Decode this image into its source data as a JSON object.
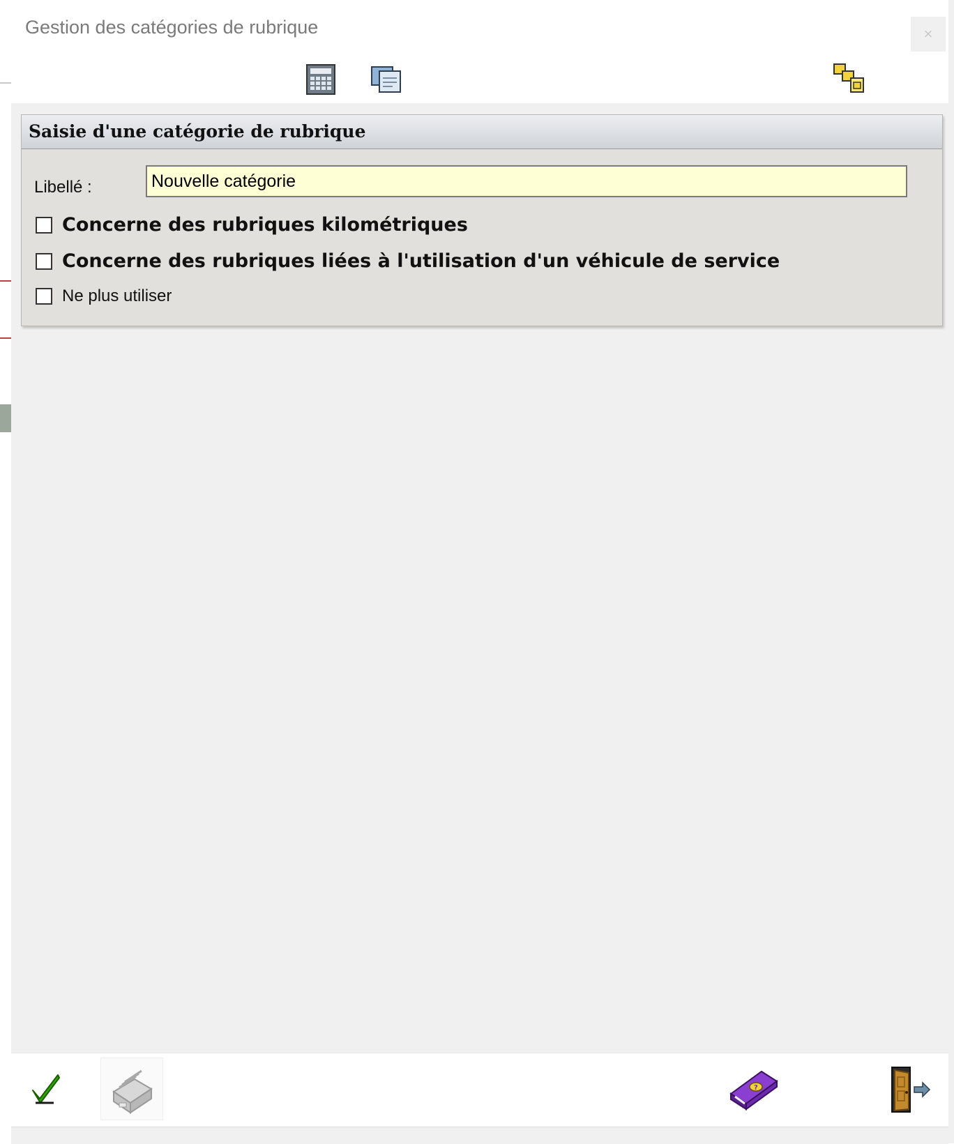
{
  "window": {
    "title": "Gestion des catégories de rubrique",
    "close_label": "×"
  },
  "toolbar": {
    "icons": [
      "calculator-icon",
      "screen-icon",
      "tile-windows-icon"
    ]
  },
  "form": {
    "group_title": "Saisie d'une catégorie de rubrique",
    "libelle_label": "Libellé :",
    "libelle_value": "Nouvelle catégorie",
    "checkbox_km_label": "Concerne des rubriques kilométriques",
    "checkbox_km_checked": false,
    "checkbox_vehicle_label": "Concerne des rubriques liées à l'utilisation d'un véhicule de service",
    "checkbox_vehicle_checked": false,
    "checkbox_unused_label": "Ne plus utiliser",
    "checkbox_unused_checked": false
  },
  "footer": {
    "buttons": [
      "validate-checkmark-icon",
      "archive-icon",
      "help-book-icon",
      "exit-door-icon"
    ]
  },
  "colors": {
    "input_background": "#ffffd6",
    "panel_background": "#f0f0f0",
    "group_background": "#e2e0dc",
    "checkmark_green": "#2fa800"
  }
}
